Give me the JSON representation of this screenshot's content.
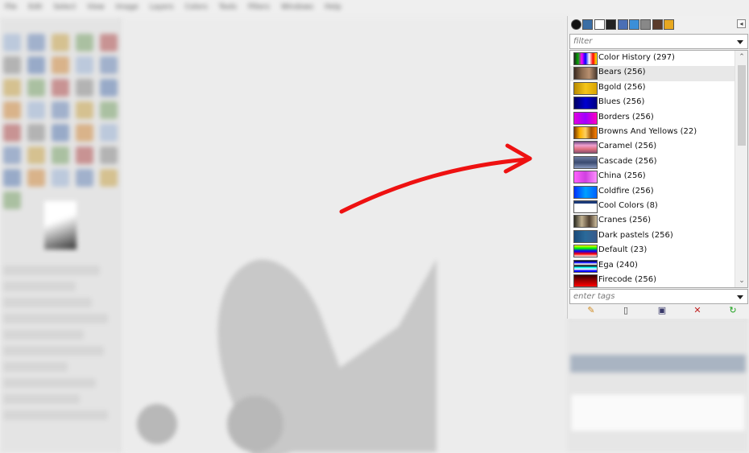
{
  "app": {
    "menu_items": [
      "File",
      "Edit",
      "Select",
      "View",
      "Image",
      "Layers",
      "Colors",
      "Tools",
      "Filters",
      "Windows",
      "Help"
    ]
  },
  "gradients_dock": {
    "filter_placeholder": "filter",
    "tags_placeholder": "enter tags",
    "menu_glyph": "◂",
    "tabs": [
      {
        "icon": "brush-circle-icon",
        "color": "#111111"
      },
      {
        "icon": "pattern-icon",
        "color": "#3a6ea5"
      },
      {
        "icon": "font-icon",
        "color": "#ffffff"
      },
      {
        "icon": "palette-icon",
        "color": "#222222"
      },
      {
        "icon": "tool-preset-icon",
        "color": "#4a6fb5"
      },
      {
        "icon": "dynamics-icon",
        "color": "#3b8fd8"
      },
      {
        "icon": "gradient-icon",
        "color": "#888888"
      },
      {
        "icon": "image-icon",
        "color": "#5a3a2a"
      },
      {
        "icon": "document-history-icon",
        "color": "#e8a820"
      }
    ],
    "gradients": [
      {
        "label": "Color History (297)",
        "swatch": "linear-gradient(90deg,#222,#0a0,#f0f,#00f,#fff,#f00,#ff0)"
      },
      {
        "label": "Bears (256)",
        "swatch": "linear-gradient(90deg,#3a2a20,#8a6a50,#b89070,#4a3a30)",
        "selected": true
      },
      {
        "label": "Bgold (256)",
        "swatch": "linear-gradient(90deg,#b88a00,#f5c518,#d9a400)"
      },
      {
        "label": "Blues (256)",
        "swatch": "linear-gradient(90deg,#000060,#0000d0,#000080)"
      },
      {
        "label": "Borders (256)",
        "swatch": "linear-gradient(90deg,#e000e0,#a000ff,#ff00c0)"
      },
      {
        "label": "Browns And Yellows (22)",
        "swatch": "linear-gradient(90deg,#7a3a00,#ffb000,#ffd060,#a05000,#ff8000)"
      },
      {
        "label": "Caramel (256)",
        "swatch": "linear-gradient(180deg,#6a4a80,#f0a0d0,#e07080,#8a5070)"
      },
      {
        "label": "Cascade (256)",
        "swatch": "linear-gradient(180deg,#6a7aa0,#3a4a70,#8a9ac0)"
      },
      {
        "label": "China (256)",
        "swatch": "linear-gradient(90deg,#ff60ff,#d040e0,#ff90ff)"
      },
      {
        "label": "Coldfire (256)",
        "swatch": "linear-gradient(90deg,#0030ff,#00a0ff,#0060ff)"
      },
      {
        "label": "Cool Colors (8)",
        "swatch": "linear-gradient(180deg,#1a3a7a 20%,#ffffff 20%,#ffffff 100%)"
      },
      {
        "label": "Cranes (256)",
        "swatch": "linear-gradient(90deg,#2a2a20,#c0b090,#504030,#d0c0a0)"
      },
      {
        "label": "Dark pastels (256)",
        "swatch": "linear-gradient(90deg,#1a4a7a,#2a6a9a,#3a5a8a)"
      },
      {
        "label": "Default (23)",
        "swatch": "linear-gradient(180deg,#ff0,#0f0,#00f,#f00,#fff)"
      },
      {
        "label": "Ega (240)",
        "swatch": "linear-gradient(180deg,#000 0%,#00f 15%,#fff 30%,#000 45%,#0ff 60%,#fff 75%,#00f 90%)"
      },
      {
        "label": "Firecode (256)",
        "swatch": "linear-gradient(180deg,#300000,#a00000,#ff0000)"
      }
    ],
    "actions": [
      {
        "icon": "edit-gradient-icon",
        "glyph": "✎",
        "color": "#d08a20"
      },
      {
        "icon": "new-gradient-icon",
        "glyph": "▯",
        "color": "#444444"
      },
      {
        "icon": "duplicate-gradient-icon",
        "glyph": "▣",
        "color": "#3a3a6a"
      },
      {
        "icon": "delete-gradient-icon",
        "glyph": "✕",
        "color": "#c02020"
      },
      {
        "icon": "refresh-gradients-icon",
        "glyph": "↻",
        "color": "#1aa01a"
      }
    ]
  },
  "annotation": {
    "arrow_color": "#ee1111"
  }
}
